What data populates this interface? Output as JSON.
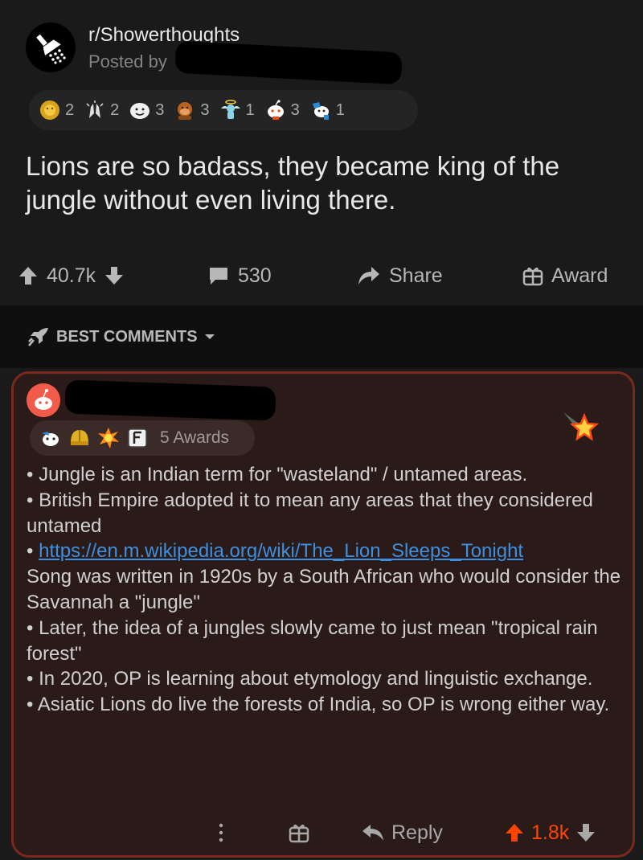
{
  "post": {
    "subreddit": "r/Showerthoughts",
    "posted_by": "Posted by",
    "awards": [
      {
        "icon": "gold-lion-award-icon",
        "count": "2"
      },
      {
        "icon": "praise-hands-award-icon",
        "count": "2"
      },
      {
        "icon": "wholesome-award-icon",
        "count": "3"
      },
      {
        "icon": "monkey-award-icon",
        "count": "3"
      },
      {
        "icon": "angel-award-icon",
        "count": "1"
      },
      {
        "icon": "snoo-award-icon",
        "count": "3"
      },
      {
        "icon": "snoo-chef-award-icon",
        "count": "1"
      }
    ],
    "title": "Lions are so badass, they became king of the jungle without even living there.",
    "votes": "40.7k",
    "comments": "530",
    "share_label": "Share",
    "award_label": "Award"
  },
  "sort": {
    "label": "BEST COMMENTS"
  },
  "comment": {
    "awards_label": "5 Awards",
    "body": [
      {
        "bullet": "•",
        "text": "Jungle is an Indian term for \"wasteland\" / untamed areas."
      },
      {
        "bullet": "•",
        "text": "British Empire adopted it to mean any areas that they considered untamed"
      },
      {
        "bullet": "•",
        "link": "https://en.m.wikipedia.org/wiki/The_Lion_Sleeps_Tonight",
        "text": "Song was written in 1920s by a South African who would consider the Savannah a \"jungle\""
      },
      {
        "bullet": "•",
        "text": "Later, the idea of a jungles slowly came to just mean \"tropical rain forest\""
      },
      {
        "bullet": "•",
        "text": "In 2020, OP is learning about etymology and linguistic exchange."
      },
      {
        "bullet": "•",
        "text": "Asiatic Lions do live the forests of India, so OP is wrong either way."
      }
    ],
    "reply_label": "Reply",
    "votes": "1.8k"
  },
  "colors": {
    "background": "#1a1a1b",
    "upvote_orange": "#ff4500",
    "link_blue": "#3d8fe0",
    "comment_border": "#7a2a1c"
  }
}
